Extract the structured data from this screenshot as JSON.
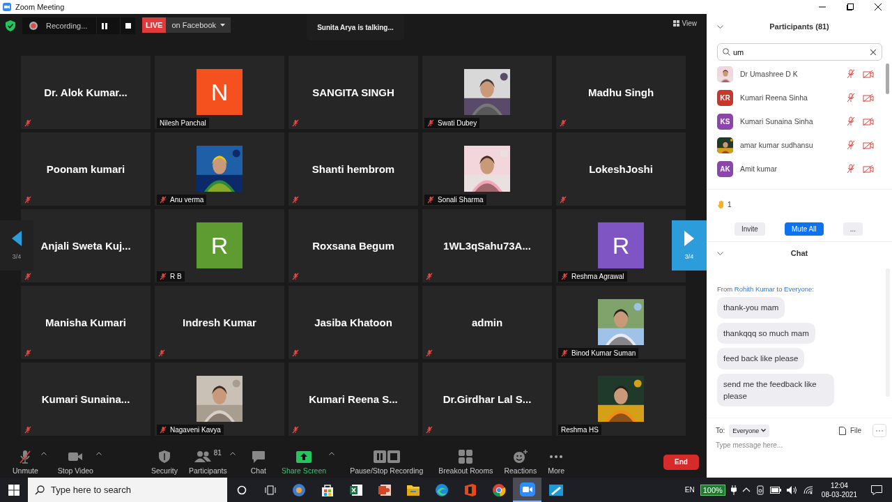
{
  "window": {
    "title": "Zoom Meeting"
  },
  "top_bar": {
    "recording_label": "Recording...",
    "live_badge": "LIVE",
    "live_destination": "on Facebook",
    "talking": "Sunita Arya is talking...",
    "view_button": "View"
  },
  "gallery": {
    "prev_page": "3/4",
    "next_page": "3/4",
    "tiles": [
      {
        "kind": "name",
        "name": "Dr. Alok Kumar...",
        "muted": true
      },
      {
        "kind": "letter",
        "letter": "N",
        "color": "#f4511e",
        "name": "Nilesh Panchal",
        "muted": false
      },
      {
        "kind": "name",
        "name": "SANGITA SINGH",
        "muted": true
      },
      {
        "kind": "picture",
        "name": "Swati Dubey",
        "muted": true
      },
      {
        "kind": "name",
        "name": "Madhu Singh",
        "muted": true
      },
      {
        "kind": "name",
        "name": "Poonam kumari",
        "muted": true
      },
      {
        "kind": "picture",
        "name": "Anu verma",
        "muted": true
      },
      {
        "kind": "name",
        "name": "Shanti hembrom",
        "muted": true
      },
      {
        "kind": "picture",
        "name": "Sonali Sharma",
        "muted": true
      },
      {
        "kind": "name",
        "name": "LokeshJoshi",
        "muted": true
      },
      {
        "kind": "name",
        "name": "Anjali Sweta Kuj...",
        "muted": true
      },
      {
        "kind": "letter",
        "letter": "R",
        "color": "#5e9c32",
        "name": "R B",
        "muted": true
      },
      {
        "kind": "name",
        "name": "Roxsana Begum",
        "muted": true
      },
      {
        "kind": "name",
        "name": "1WL3qSahu73A...",
        "muted": true
      },
      {
        "kind": "letter",
        "letter": "R",
        "color": "#7e55c2",
        "name": "Reshma Agrawal",
        "muted": true
      },
      {
        "kind": "name",
        "name": "Manisha Kumari",
        "muted": true
      },
      {
        "kind": "name",
        "name": "Indresh Kumar",
        "muted": true
      },
      {
        "kind": "name",
        "name": "Jasiba Khatoon",
        "muted": true
      },
      {
        "kind": "name",
        "name": "admin",
        "muted": true
      },
      {
        "kind": "picture",
        "name": "Binod Kumar Suman",
        "muted": true
      },
      {
        "kind": "name",
        "name": "Kumari Sunaina...",
        "muted": true
      },
      {
        "kind": "picture",
        "name": "Nagaveni Kavya",
        "muted": true
      },
      {
        "kind": "name",
        "name": "Kumari Reena S...",
        "muted": true
      },
      {
        "kind": "name",
        "name": "Dr.Girdhar Lal S...",
        "muted": true
      },
      {
        "kind": "picture",
        "name": "Reshma HS",
        "muted": false
      }
    ]
  },
  "toolbar": {
    "items": [
      {
        "kind": "unmute",
        "label": "Unmute",
        "caret": true
      },
      {
        "kind": "video",
        "label": "Stop Video",
        "caret": true
      },
      {
        "kind": "security",
        "label": "Security",
        "caret": false
      },
      {
        "kind": "participants",
        "label": "Participants",
        "count": "81",
        "caret": true
      },
      {
        "kind": "chat",
        "label": "Chat",
        "caret": false
      },
      {
        "kind": "share",
        "label": "Share Screen",
        "caret": true
      },
      {
        "kind": "recording",
        "label": "Pause/Stop Recording",
        "caret": false
      },
      {
        "kind": "breakout",
        "label": "Breakout Rooms",
        "caret": false
      },
      {
        "kind": "reactions",
        "label": "Reactions",
        "caret": false
      },
      {
        "kind": "more",
        "label": "More",
        "caret": false
      }
    ],
    "end_button": "End"
  },
  "participants_panel": {
    "title": "Participants (81)",
    "search": "um",
    "people": [
      {
        "name": "Dr Umashree D K",
        "kind": "picture",
        "muted": true,
        "video_off": true
      },
      {
        "name": "Kumari Reena Sinha",
        "kind": "initials",
        "initials": "KR",
        "color": "#c9372c",
        "muted": true,
        "video_off": true
      },
      {
        "name": "Kumari Sunaina Sinha",
        "kind": "initials",
        "initials": "KS",
        "color": "#8e44ad",
        "muted": true,
        "video_off": true
      },
      {
        "name": "amar kumar sudhansu",
        "kind": "picture",
        "muted": true,
        "video_off": true
      },
      {
        "name": "Amit kumar",
        "kind": "initials",
        "initials": "AK",
        "color": "#8e44ad",
        "muted": true,
        "video_off": true
      }
    ],
    "raised_hands": "1",
    "buttons": [
      {
        "label": "Invite",
        "primary": false
      },
      {
        "label": "Mute All",
        "primary": true
      },
      {
        "label": "...",
        "primary": false
      }
    ]
  },
  "chat": {
    "title": "Chat",
    "from_label": "From",
    "sender": "Rohith Kumar",
    "to_label": "to",
    "recipient": "Everyone:",
    "messages": [
      "thank-you mam",
      "thankqqq so much mam",
      "feed back like please",
      "send me the feedback like please"
    ],
    "composer": {
      "to_label": "To:",
      "recipient": "Everyone",
      "file_button": "File",
      "placeholder": "Type message here..."
    }
  },
  "taskbar": {
    "search_placeholder": "Type here to search",
    "apps": [
      {
        "kind": "media",
        "selected": false
      },
      {
        "kind": "store",
        "selected": false
      },
      {
        "kind": "excel",
        "selected": false
      },
      {
        "kind": "powerpoint",
        "selected": false
      },
      {
        "kind": "folder",
        "selected": false
      },
      {
        "kind": "edge",
        "selected": false
      },
      {
        "kind": "office",
        "selected": false
      },
      {
        "kind": "chrome",
        "selected": false
      },
      {
        "kind": "zoom",
        "selected": true
      },
      {
        "kind": "whiteboard",
        "selected": false
      }
    ],
    "language": "EN",
    "battery": "100%",
    "time": "12:04",
    "date": "08-03-2021"
  }
}
